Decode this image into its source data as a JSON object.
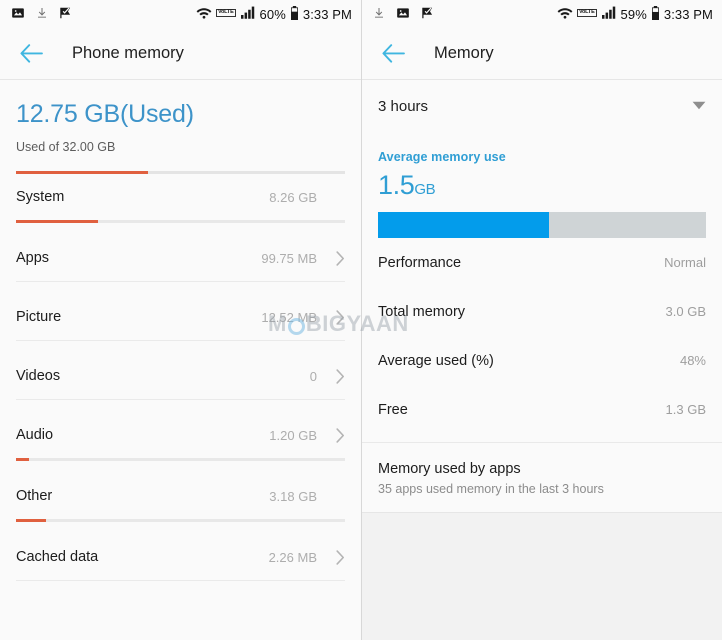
{
  "left": {
    "statusbar": {
      "icons": [
        "image-icon",
        "download-icon",
        "flag-check-icon"
      ],
      "wifi": "wifi-icon",
      "volte": "VoLTE",
      "signal": "signal-bars-icon",
      "battery_text": "60%",
      "battery": "battery-icon",
      "time": "3:33 PM"
    },
    "appbar": {
      "back": "back-arrow-icon",
      "title": "Phone memory"
    },
    "hero": {
      "value": "12.75 GB(Used)",
      "subtitle": "Used of 32.00 GB",
      "fill_percent": 40
    },
    "rows": [
      {
        "label": "System",
        "value": "8.26 GB",
        "fill_percent": 25,
        "has_bar": true,
        "has_chevron": false
      },
      {
        "label": "Apps",
        "value": "99.75 MB",
        "fill_percent": 0,
        "has_bar": false,
        "has_chevron": true
      },
      {
        "label": "Picture",
        "value": "12.52 MB",
        "fill_percent": 0,
        "has_bar": false,
        "has_chevron": true
      },
      {
        "label": "Videos",
        "value": "0",
        "fill_percent": 0,
        "has_bar": false,
        "has_chevron": true
      },
      {
        "label": "Audio",
        "value": "1.20 GB",
        "fill_percent": 4,
        "has_bar": true,
        "has_chevron": true
      },
      {
        "label": "Other",
        "value": "3.18 GB",
        "fill_percent": 9,
        "has_bar": true,
        "has_chevron": false
      },
      {
        "label": "Cached data",
        "value": "2.26 MB",
        "fill_percent": 0,
        "has_bar": false,
        "has_chevron": true
      }
    ]
  },
  "right": {
    "statusbar": {
      "icons": [
        "download-icon",
        "image-icon",
        "flag-check-icon"
      ],
      "wifi": "wifi-icon",
      "volte": "VoLTE",
      "signal": "signal-bars-icon",
      "battery_text": "59%",
      "battery": "battery-icon",
      "time": "3:33 PM"
    },
    "appbar": {
      "back": "back-arrow-icon",
      "title": "Memory"
    },
    "period": {
      "label": "3 hours",
      "caret": "chevron-down-icon"
    },
    "average": {
      "title": "Average memory use",
      "value": "1.5",
      "unit": "GB",
      "fill_percent": 52
    },
    "stats": [
      {
        "label": "Performance",
        "value": "Normal"
      },
      {
        "label": "Total memory",
        "value": "3.0 GB"
      },
      {
        "label": "Average used (%)",
        "value": "48%"
      },
      {
        "label": "Free",
        "value": "1.3 GB"
      }
    ],
    "apps": {
      "title": "Memory used by apps",
      "subtitle": "35 apps used memory in the last 3 hours"
    }
  },
  "watermark": {
    "text_before": "M",
    "text_after": "BIGYAAN"
  },
  "colors": {
    "accent_blue": "#3d93c9",
    "bar_blue": "#039ceb",
    "bar_orange": "#e0603f",
    "back_arrow": "#3fb6e0"
  }
}
